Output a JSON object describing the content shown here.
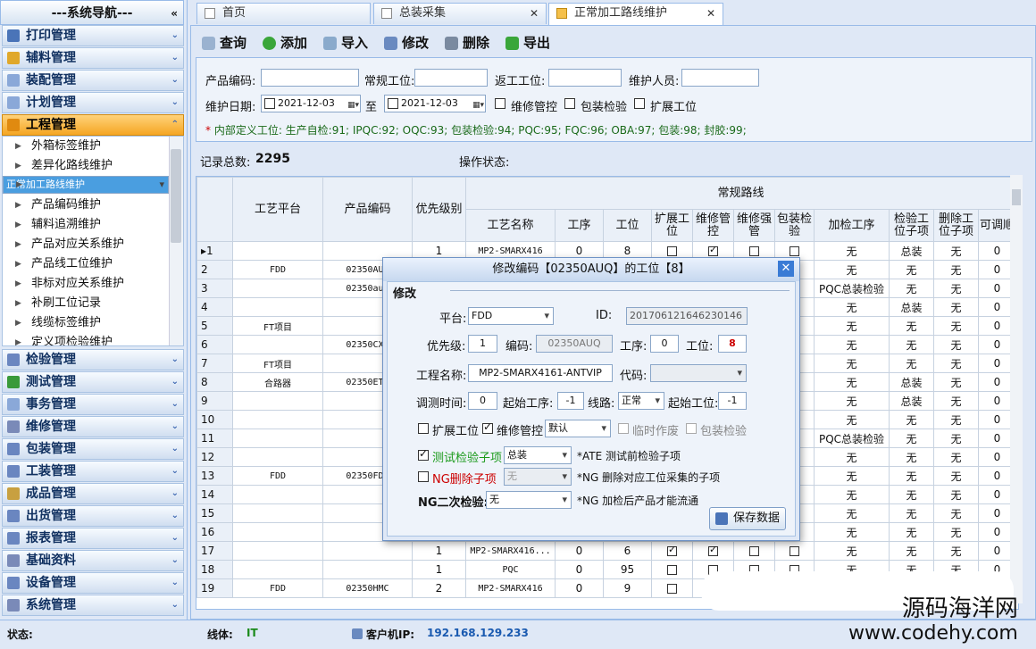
{
  "nav": {
    "title": "---系统导航---",
    "collapse_icon": "«",
    "sections": [
      {
        "label": "打印管理",
        "color": "#4a74b8"
      },
      {
        "label": "辅料管理",
        "color": "#e0a82a"
      },
      {
        "label": "装配管理",
        "color": "#8aa8d8"
      },
      {
        "label": "计划管理",
        "color": "#8aa8d8"
      },
      {
        "label": "工程管理",
        "color": "#e08a10"
      }
    ],
    "sub_items": [
      "外箱标签维护",
      "差异化路线维护",
      "正常加工路线维护",
      "产品编码维护",
      "辅料追溯维护",
      "产品对应关系维护",
      "产品线工位维护",
      "非标对应关系维护",
      "补刷工位记录",
      "线缆标签维护",
      "定义项检验维护"
    ],
    "selected_sub": 2,
    "lower_sections": [
      {
        "label": "检验管理",
        "color": "#6a86c0"
      },
      {
        "label": "测试管理",
        "color": "#3a9a3a"
      },
      {
        "label": "事务管理",
        "color": "#8aa8d8"
      },
      {
        "label": "维修管理",
        "color": "#7a8ab8"
      },
      {
        "label": "包装管理",
        "color": "#6a86c0"
      },
      {
        "label": "工装管理",
        "color": "#6a86c0"
      },
      {
        "label": "成品管理",
        "color": "#c8a040"
      },
      {
        "label": "出货管理",
        "color": "#6a86c0"
      },
      {
        "label": "报表管理",
        "color": "#6a86c0"
      },
      {
        "label": "基础资料",
        "color": "#7a8ab8"
      },
      {
        "label": "设备管理",
        "color": "#6a86c0"
      },
      {
        "label": "系统管理",
        "color": "#7a8ab8"
      }
    ]
  },
  "tabs": [
    "首页",
    "总装采集",
    "正常加工路线维护"
  ],
  "toolbar": {
    "query": "查询",
    "add": "添加",
    "import": "导入",
    "edit": "修改",
    "delete": "删除",
    "export": "导出"
  },
  "search": {
    "product_code_label": "产品编码:",
    "regular_station_label": "常规工位:",
    "rework_station_label": "返工工位:",
    "maintainer_label": "维护人员:",
    "date_label": "维护日期:",
    "date_from": "2021-12-03",
    "to_label": "至",
    "date_to": "2021-12-03",
    "repair_control": "维修管控",
    "package_check": "包装检验",
    "extend_station": "扩展工位",
    "notice_star": "*",
    "notice": "内部定义工位: 生产自检:91; IPQC:92; OQC:93; 包装检验:94; PQC:95; FQC:96; OBA:97; 包装:98; 封胶:99;"
  },
  "stats": {
    "count_label": "记录总数:",
    "count": "2295",
    "op_label": "操作状态:"
  },
  "grid": {
    "group_header": "常规路线",
    "headers": [
      "工艺平台",
      "产品编码",
      "优先级别",
      "工艺名称",
      "工序",
      "工位",
      "扩展工位",
      "维修管控",
      "维修强管",
      "包装检验",
      "加检工序",
      "检验工位子项",
      "删除工位子项",
      "可调顺"
    ],
    "rows": [
      {
        "n": "1",
        "plat": "",
        "code": "",
        "pri": "1",
        "name": "MP2-SMARX416",
        "seq": "0",
        "st": "8",
        "c1": false,
        "c2": true,
        "c3": false,
        "c4": false,
        "add": "无",
        "chk": "总装",
        "del": "无",
        "adj": "0"
      },
      {
        "n": "2",
        "plat": "FDD",
        "code": "02350AUQ",
        "pri": "",
        "name": "",
        "seq": "",
        "st": "",
        "c1": false,
        "c2": false,
        "c3": false,
        "c4": false,
        "add": "无",
        "chk": "无",
        "del": "无",
        "adj": "0"
      },
      {
        "n": "3",
        "plat": "",
        "code": "02350auq",
        "pri": "",
        "name": "",
        "seq": "",
        "st": "",
        "c1": false,
        "c2": false,
        "c3": false,
        "c4": false,
        "add": "PQC总装检验",
        "chk": "无",
        "del": "无",
        "adj": "0"
      },
      {
        "n": "4",
        "plat": "",
        "code": "",
        "pri": "",
        "name": "",
        "seq": "",
        "st": "",
        "c1": false,
        "c2": false,
        "c3": false,
        "c4": false,
        "add": "无",
        "chk": "总装",
        "del": "无",
        "adj": "0"
      },
      {
        "n": "5",
        "plat": "FT项目",
        "code": "",
        "pri": "",
        "name": "",
        "seq": "",
        "st": "",
        "c1": false,
        "c2": false,
        "c3": false,
        "c4": false,
        "add": "无",
        "chk": "无",
        "del": "无",
        "adj": "0"
      },
      {
        "n": "6",
        "plat": "",
        "code": "02350CXN",
        "pri": "",
        "name": "",
        "seq": "",
        "st": "",
        "c1": false,
        "c2": false,
        "c3": false,
        "c4": false,
        "add": "无",
        "chk": "无",
        "del": "无",
        "adj": "0"
      },
      {
        "n": "7",
        "plat": "FT项目",
        "code": "",
        "pri": "",
        "name": "",
        "seq": "",
        "st": "",
        "c1": false,
        "c2": false,
        "c3": false,
        "c4": false,
        "add": "无",
        "chk": "无",
        "del": "无",
        "adj": "0"
      },
      {
        "n": "8",
        "plat": "合路器",
        "code": "02350ETA",
        "pri": "",
        "name": "",
        "seq": "",
        "st": "",
        "c1": false,
        "c2": false,
        "c3": false,
        "c4": false,
        "add": "无",
        "chk": "总装",
        "del": "无",
        "adj": "0"
      },
      {
        "n": "9",
        "plat": "",
        "code": "",
        "pri": "",
        "name": "",
        "seq": "",
        "st": "",
        "c1": false,
        "c2": false,
        "c3": false,
        "c4": false,
        "add": "无",
        "chk": "总装",
        "del": "无",
        "adj": "0"
      },
      {
        "n": "10",
        "plat": "",
        "code": "",
        "pri": "",
        "name": "",
        "seq": "",
        "st": "",
        "c1": false,
        "c2": false,
        "c3": false,
        "c4": false,
        "add": "无",
        "chk": "无",
        "del": "无",
        "adj": "0"
      },
      {
        "n": "11",
        "plat": "",
        "code": "",
        "pri": "",
        "name": "",
        "seq": "",
        "st": "",
        "c1": false,
        "c2": false,
        "c3": false,
        "c4": false,
        "add": "PQC总装检验",
        "chk": "无",
        "del": "无",
        "adj": "0"
      },
      {
        "n": "12",
        "plat": "",
        "code": "",
        "pri": "",
        "name": "",
        "seq": "",
        "st": "",
        "c1": false,
        "c2": false,
        "c3": false,
        "c4": false,
        "add": "无",
        "chk": "无",
        "del": "无",
        "adj": "0"
      },
      {
        "n": "13",
        "plat": "FDD",
        "code": "02350FDP",
        "pri": "",
        "name": "",
        "seq": "",
        "st": "",
        "c1": false,
        "c2": false,
        "c3": false,
        "c4": false,
        "add": "无",
        "chk": "无",
        "del": "无",
        "adj": "0"
      },
      {
        "n": "14",
        "plat": "",
        "code": "",
        "pri": "",
        "name": "",
        "seq": "",
        "st": "",
        "c1": false,
        "c2": false,
        "c3": false,
        "c4": false,
        "add": "无",
        "chk": "无",
        "del": "无",
        "adj": "0"
      },
      {
        "n": "15",
        "plat": "",
        "code": "",
        "pri": "",
        "name": "",
        "seq": "",
        "st": "",
        "c1": false,
        "c2": false,
        "c3": false,
        "c4": false,
        "add": "无",
        "chk": "无",
        "del": "无",
        "adj": "0"
      },
      {
        "n": "16",
        "plat": "",
        "code": "",
        "pri": "",
        "name": "",
        "seq": "",
        "st": "",
        "c1": false,
        "c2": false,
        "c3": false,
        "c4": false,
        "add": "无",
        "chk": "无",
        "del": "无",
        "adj": "0"
      },
      {
        "n": "17",
        "plat": "",
        "code": "",
        "pri": "1",
        "name": "MP2-SMARX416...",
        "seq": "0",
        "st": "6",
        "c1": true,
        "c2": true,
        "c3": false,
        "c4": false,
        "add": "无",
        "chk": "无",
        "del": "无",
        "adj": "0"
      },
      {
        "n": "18",
        "plat": "",
        "code": "",
        "pri": "1",
        "name": "PQC",
        "seq": "0",
        "st": "95",
        "c1": false,
        "c2": false,
        "c3": false,
        "c4": false,
        "add": "无",
        "chk": "无",
        "del": "无",
        "adj": "0"
      },
      {
        "n": "19",
        "plat": "FDD",
        "code": "02350HMC",
        "pri": "2",
        "name": "MP2-SMARX416",
        "seq": "0",
        "st": "9",
        "c1": false,
        "c2": false,
        "c3": false,
        "c4": false,
        "add": "无",
        "chk": "无",
        "del": "无",
        "adj": "0"
      }
    ]
  },
  "dialog": {
    "title": "修改编码【02350AUQ】的工位【8】",
    "section": "修改",
    "platform_label": "平台:",
    "platform": "FDD",
    "id_label": "ID:",
    "id": "201706121646230146",
    "priority_label": "优先级:",
    "priority": "1",
    "code_label": "编码:",
    "code": "02350AUQ",
    "seq_label": "工序:",
    "seq": "0",
    "station_label": "工位:",
    "station": "8",
    "name_label": "工程名称:",
    "name": "MP2-SMARX4161-ANTVIP",
    "dcode_label": "代码:",
    "dcode": "",
    "time_label": "调测时间:",
    "time": "0",
    "start_seq_label": "起始工序:",
    "start_seq": "-1",
    "line_label": "线路:",
    "line": "正常",
    "start_station_label": "起始工位:",
    "start_station": "-1",
    "extend_label": "扩展工位",
    "repair_label": "维修管控",
    "repair_mode": "默认",
    "temp_label": "临时作废",
    "pack_label": "包装检验",
    "test_sub_label": "测试检验子项",
    "test_sub": "总装",
    "test_sub_note": "*ATE 测试前检验子项",
    "ng_del_label": "NG删除子项",
    "ng_del": "无",
    "ng_del_note": "*NG 删除对应工位采集的子项",
    "ng2_label": "NG二次检验:",
    "ng2": "无",
    "ng2_note": "*NG 加检后产品才能流通",
    "save": "保存数据",
    "close_icon": "✕"
  },
  "status": {
    "state_label": "状态:",
    "line_label": "线体:",
    "line": "IT",
    "ip_label": "客户机IP:",
    "ip": "192.168.129.233"
  },
  "watermark": {
    "line1": "源码海洋网",
    "line2": "www.codehy.com"
  }
}
